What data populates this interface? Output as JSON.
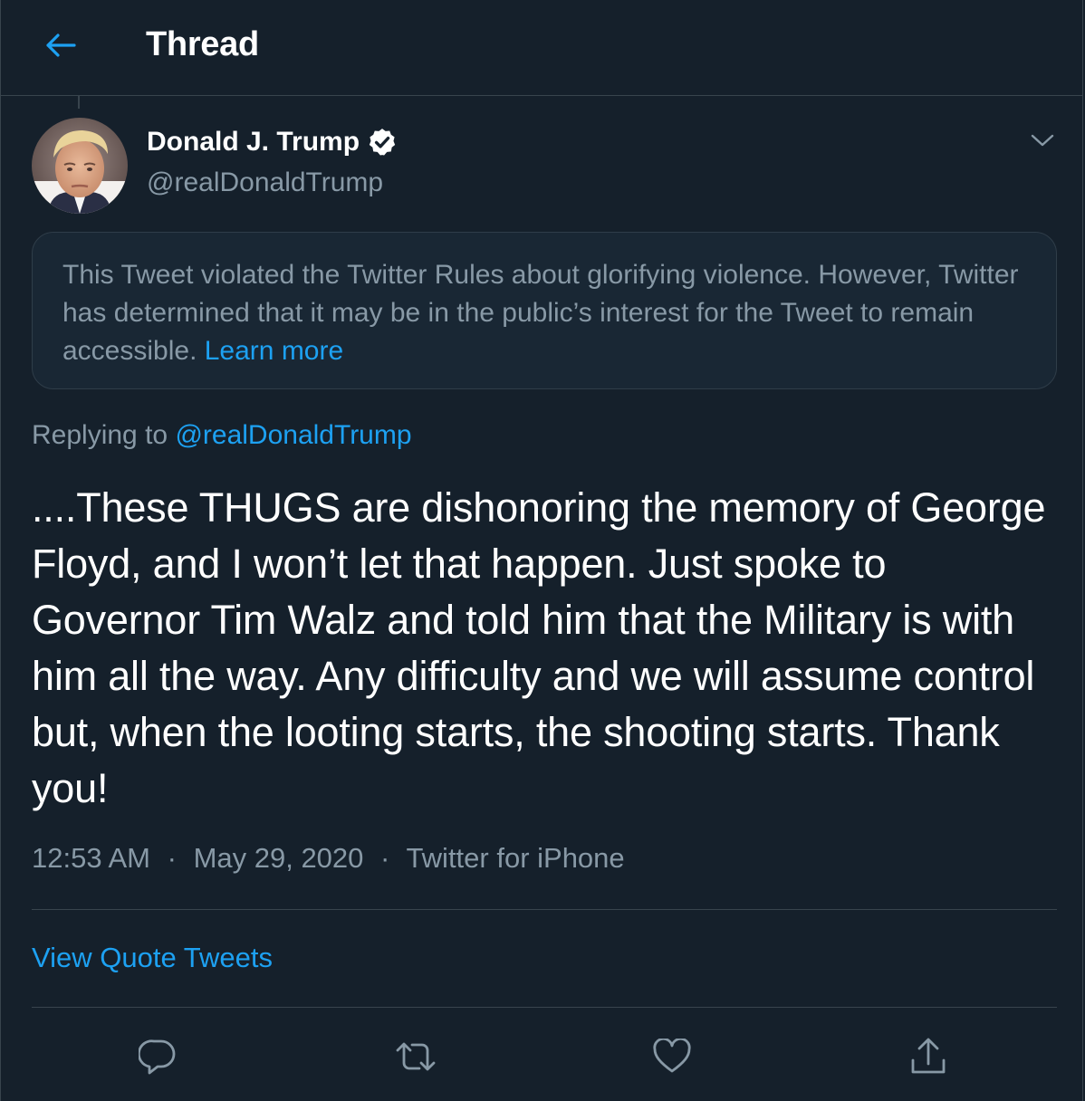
{
  "header": {
    "title": "Thread",
    "back_icon": "arrow-left-icon",
    "accent_color": "#1da1f2"
  },
  "tweet": {
    "author_name": "Donald J. Trump",
    "author_handle": "@realDonaldTrump",
    "verified_icon": "verified-badge-icon",
    "notice_text": "This Tweet violated the Twitter Rules about glorifying violence. However, Twitter has determined that it may be in the public’s interest for the Tweet to remain accessible.",
    "notice_link": "Learn more",
    "replying_prefix": "Replying to",
    "replying_handle": "@realDonaldTrump",
    "text": "....These THUGS are dishonoring the memory of George Floyd, and I won’t let that happen. Just spoke to Governor Tim Walz and told him that the Military is with him all the way. Any difficulty and we will assume control but, when the looting starts, the shooting starts. Thank you!",
    "time": "12:53 AM",
    "date": "May 29, 2020",
    "source": "Twitter for iPhone",
    "separator": "·",
    "view_quotes_label": "View Quote Tweets"
  },
  "actions": [
    {
      "icon": "reply-icon"
    },
    {
      "icon": "retweet-icon"
    },
    {
      "icon": "like-icon"
    },
    {
      "icon": "share-icon"
    }
  ],
  "colors": {
    "background": "#15202b",
    "border": "#38444d",
    "secondary_text": "#8899a6",
    "notice_background": "#192734"
  }
}
